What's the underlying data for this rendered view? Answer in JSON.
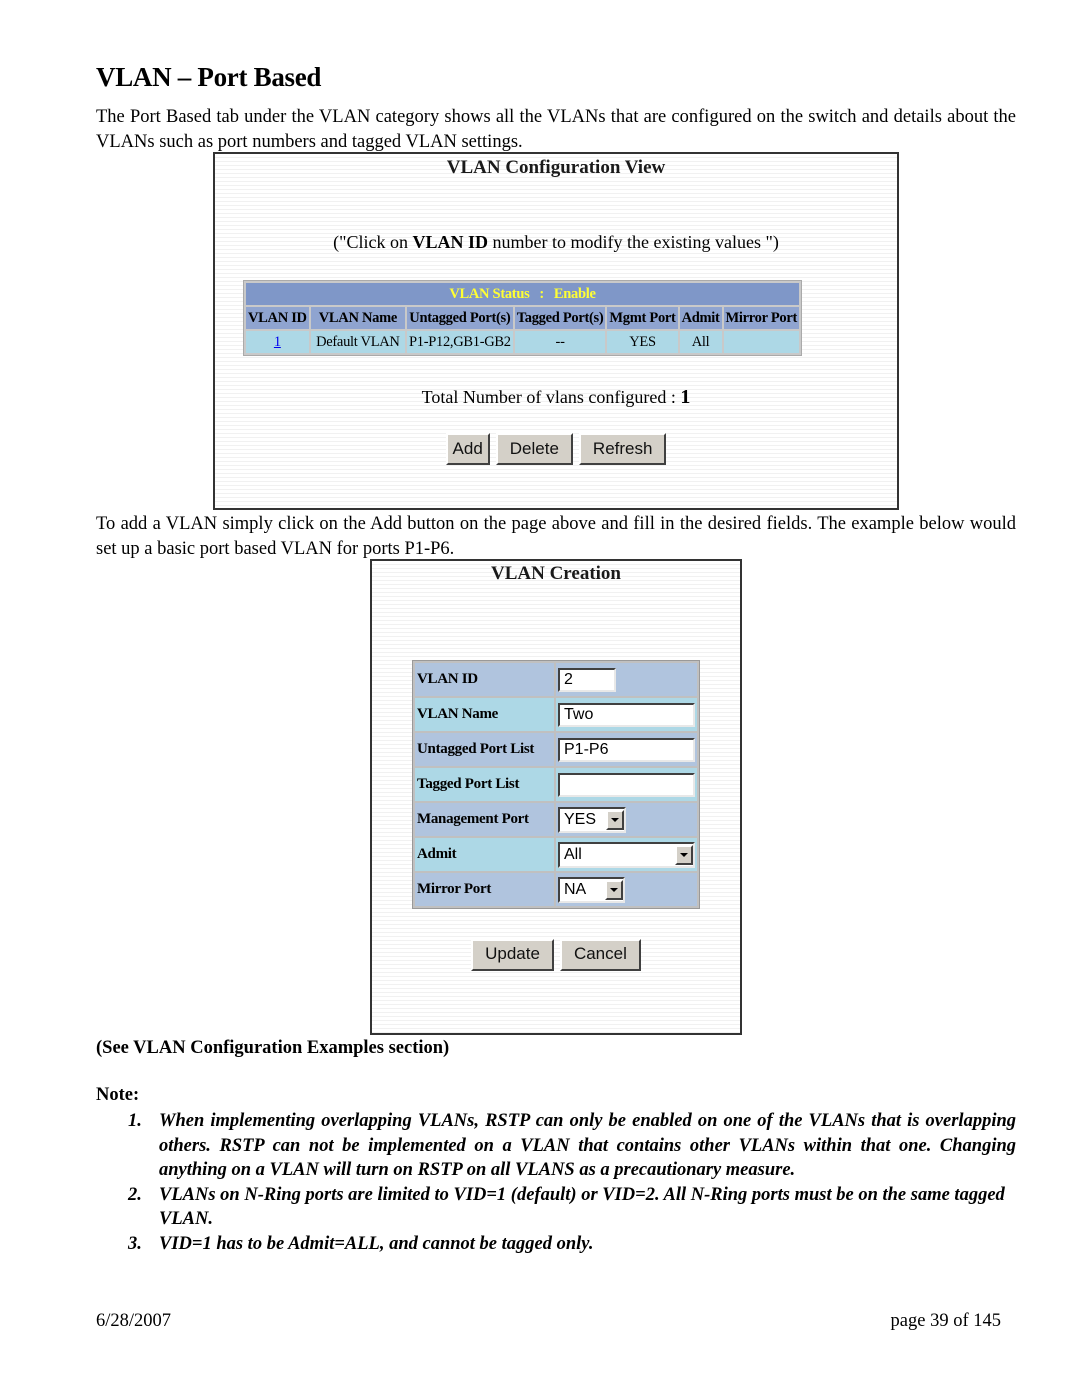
{
  "document": {
    "title": "VLAN – Port Based",
    "intro_paragraph": "The Port Based tab under the VLAN category shows all the VLANs that are configured on the switch and details about the VLANs such as port numbers and tagged VLAN settings.",
    "add_paragraph": "To add a VLAN simply click on the Add button on the page above and fill in the desired fields.  The example below would set up a basic port based VLAN for ports P1-P6.",
    "caption": "(See VLAN Configuration Examples section)",
    "note_label": "Note:",
    "notes": [
      {
        "num": "1.",
        "text": "When implementing overlapping VLANs, RSTP can only be enabled on one of the VLANs that is overlapping others.  RSTP can not be implemented on a VLAN that contains other VLANs within that one.  Changing anything on a VLAN will turn on RSTP on all VLANS as a precautionary measure."
      },
      {
        "num": "2.",
        "text": "VLANs on N-Ring ports are limited to VID=1 (default) or VID=2.  All N-Ring ports must be on the same tagged VLAN."
      },
      {
        "num": "3.",
        "text": "VID=1 has to be Admit=ALL, and cannot be tagged only."
      }
    ],
    "footer": {
      "date": "6/28/2007",
      "page": "page 39 of 145"
    }
  },
  "config_view": {
    "title": "VLAN Configuration View",
    "hint_prefix": "(\"Click on ",
    "hint_bold": "VLAN ID",
    "hint_suffix": " number to modify the existing values \")",
    "status_text": "VLAN Status   :   Enable",
    "columns": [
      "VLAN ID",
      "VLAN Name",
      "Untagged Port(s)",
      "Tagged Port(s)",
      "Mgmt Port",
      "Admit",
      "Mirror Port"
    ],
    "rows": [
      {
        "vlan_id": "1",
        "vlan_name": "Default VLAN",
        "untagged": "P1-P12,GB1-GB2",
        "tagged": "--",
        "mgmt": "YES",
        "admit": "All",
        "mirror": ""
      }
    ],
    "total_label": "Total Number of vlans configured : ",
    "total_value": "1",
    "buttons": {
      "add": "Add",
      "delete": "Delete",
      "refresh": "Refresh"
    }
  },
  "creation": {
    "title": "VLAN Creation",
    "fields": {
      "vlan_id": {
        "label": "VLAN ID",
        "value": "2"
      },
      "vlan_name": {
        "label": "VLAN Name",
        "value": "Two"
      },
      "untagged": {
        "label": "Untagged Port List",
        "value": "P1-P6"
      },
      "tagged": {
        "label": "Tagged Port List",
        "value": ""
      },
      "mgmt": {
        "label": "Management Port",
        "value": "YES"
      },
      "admit": {
        "label": "Admit",
        "value": "All"
      },
      "mirror": {
        "label": "Mirror Port",
        "value": "NA"
      }
    },
    "buttons": {
      "update": "Update",
      "cancel": "Cancel"
    }
  },
  "colors": {
    "status_bg": "#7f97c8",
    "status_text": "#ffff33",
    "header_bg": "#8fa4d0",
    "data_bg": "#add8e6",
    "form_row_a": "#b0c4de",
    "form_row_b": "#add8e6",
    "button_face": "#d4d0c8",
    "link": "#0000ee"
  }
}
